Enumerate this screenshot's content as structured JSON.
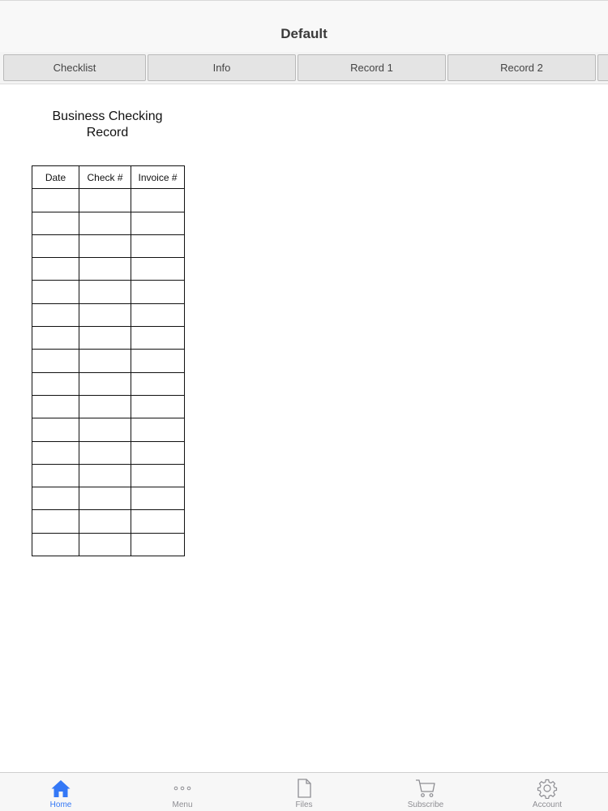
{
  "header": {
    "title": "Default"
  },
  "tabs": [
    {
      "label": "Checklist"
    },
    {
      "label": "Info"
    },
    {
      "label": "Record 1"
    },
    {
      "label": "Record 2"
    }
  ],
  "document": {
    "title": "Business Checking Record",
    "table": {
      "columns": [
        "Date",
        "Check #",
        "Invoice #"
      ],
      "row_count": 16
    }
  },
  "tab_bar": {
    "items": [
      {
        "label": "Home",
        "icon": "home-icon",
        "active": true
      },
      {
        "label": "Menu",
        "icon": "more-icon",
        "active": false
      },
      {
        "label": "Files",
        "icon": "file-icon",
        "active": false
      },
      {
        "label": "Subscribe",
        "icon": "cart-icon",
        "active": false
      },
      {
        "label": "Account",
        "icon": "gear-icon",
        "active": false
      }
    ]
  },
  "colors": {
    "accent": "#3478f6",
    "inactive": "#8e8e93"
  }
}
